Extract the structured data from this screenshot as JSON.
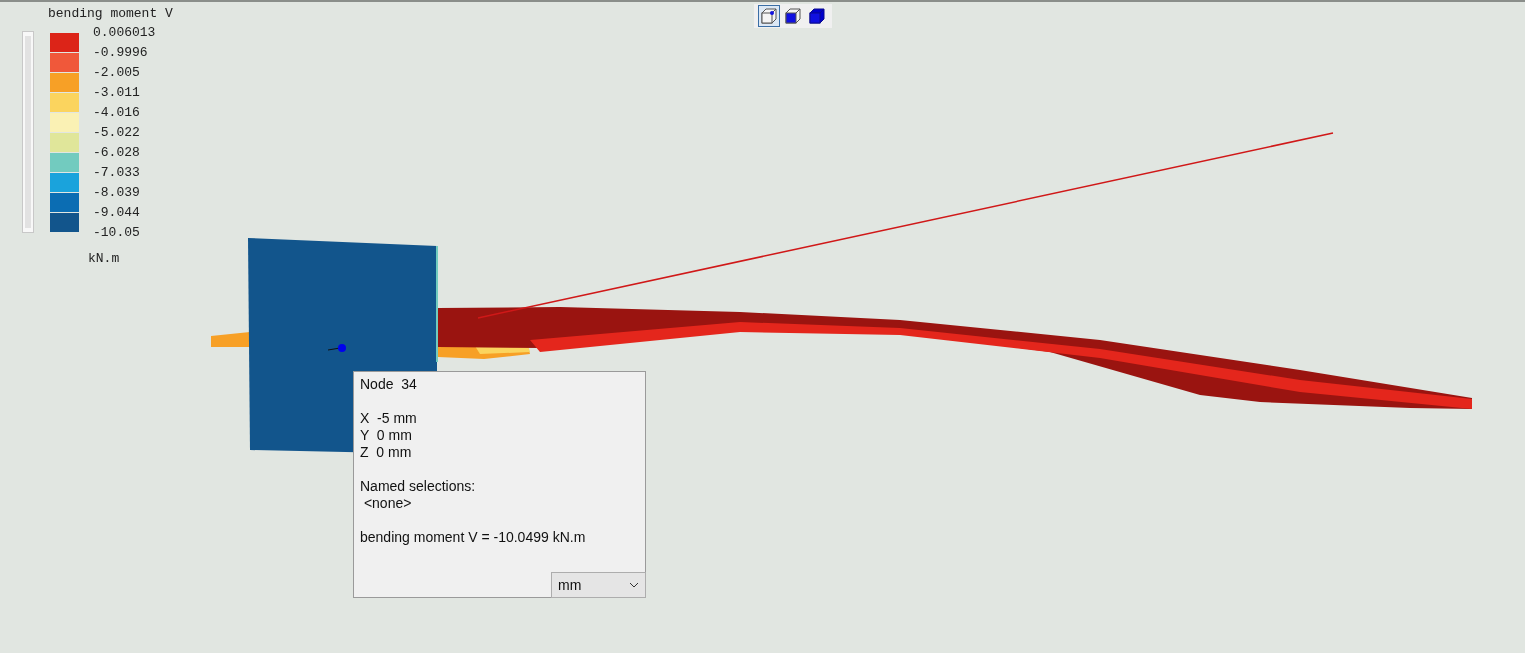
{
  "legend": {
    "title": "bending moment V",
    "bands": [
      {
        "color": "#dc2418"
      },
      {
        "color": "#f0583a"
      },
      {
        "color": "#f7a026"
      },
      {
        "color": "#fbd45e"
      },
      {
        "color": "#faf1b4"
      },
      {
        "color": "#e0e69a"
      },
      {
        "color": "#72cbbf"
      },
      {
        "color": "#1aa3dc"
      },
      {
        "color": "#0b6db3"
      },
      {
        "color": "#12558c"
      }
    ],
    "ticks": [
      "0.006013",
      "-0.9996",
      "-2.005",
      "-3.011",
      "-4.016",
      "-5.022",
      "-6.028",
      "-7.033",
      "-8.039",
      "-9.044",
      "-10.05"
    ],
    "unit": "kN.m",
    "range_slider": {
      "level": 1
    }
  },
  "view_buttons": [
    {
      "kind": "wireframe",
      "selected": true
    },
    {
      "kind": "shaded-edges",
      "selected": false
    },
    {
      "kind": "shaded",
      "selected": false
    }
  ],
  "node_popup": {
    "title": "Node  34",
    "coordinates": [
      "X  -5 mm",
      "Y  0 mm",
      "Z  0 mm"
    ],
    "selections_label": "Named selections:",
    "selections_value": "<none>",
    "result": "bending moment V = -10.0499 kN.m",
    "unit_select": {
      "value": "mm"
    }
  }
}
